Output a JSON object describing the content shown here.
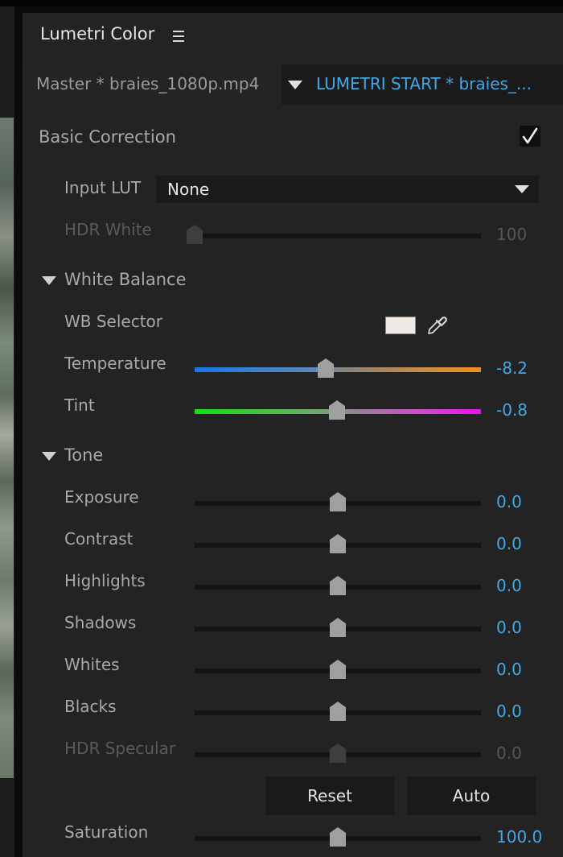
{
  "panel": {
    "title": "Lumetri Color",
    "menu_icon": "hamburger-menu-icon"
  },
  "clip_bar": {
    "master_label": "Master * braies_1080p.mp4",
    "active_label": "LUMETRI START * braies_..."
  },
  "basic_correction": {
    "title": "Basic Correction",
    "enabled": true,
    "input_lut": {
      "label": "Input LUT",
      "value": "None"
    },
    "hdr_white": {
      "label": "HDR White",
      "value": "100",
      "level": 0.0,
      "disabled": true
    }
  },
  "white_balance": {
    "title": "White Balance",
    "wb_selector": {
      "label": "WB Selector",
      "swatch_color": "#efe9e3",
      "icon": "eyedropper-icon"
    },
    "temperature": {
      "label": "Temperature",
      "value": "-8.2",
      "level": 0.459
    },
    "tint": {
      "label": "Tint",
      "value": "-0.8",
      "level": 0.496
    }
  },
  "tone": {
    "title": "Tone",
    "sliders": [
      {
        "label": "Exposure",
        "value": "0.0",
        "level": 0.5
      },
      {
        "label": "Contrast",
        "value": "0.0",
        "level": 0.5
      },
      {
        "label": "Highlights",
        "value": "0.0",
        "level": 0.5
      },
      {
        "label": "Shadows",
        "value": "0.0",
        "level": 0.5
      },
      {
        "label": "Whites",
        "value": "0.0",
        "level": 0.5
      },
      {
        "label": "Blacks",
        "value": "0.0",
        "level": 0.5
      },
      {
        "label": "HDR Specular",
        "value": "0.0",
        "level": 0.5,
        "disabled": true
      }
    ],
    "reset_label": "Reset",
    "auto_label": "Auto"
  },
  "saturation": {
    "label": "Saturation",
    "value": "100.0",
    "level": 0.5
  },
  "colors": {
    "accent_blue": "#3fa9e8",
    "panel_bg": "#232323",
    "label_gray": "#a8a8a8",
    "disabled_gray": "#5a5a5a"
  }
}
